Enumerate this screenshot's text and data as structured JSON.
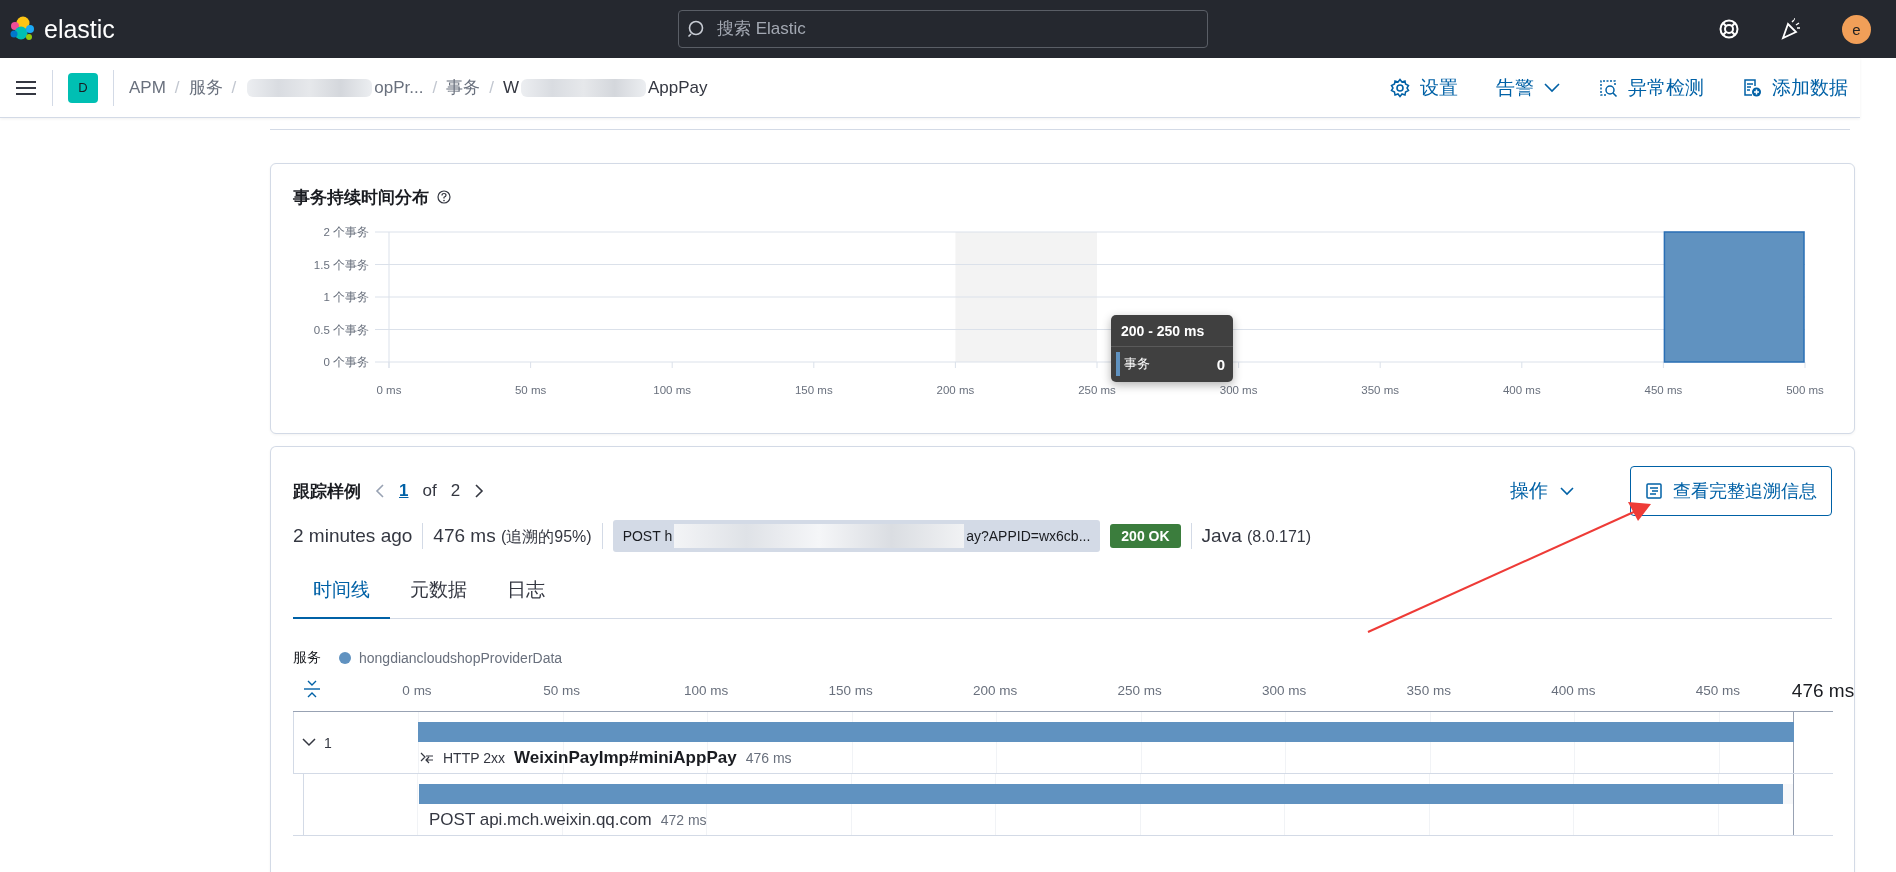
{
  "header": {
    "logo": "elastic",
    "search": {
      "placeholder": "搜索 Elastic"
    },
    "avatar": "e"
  },
  "breadcrumb_bar": {
    "space": "D",
    "separator": "/",
    "crumbs": [
      {
        "label": "APM",
        "current": false
      },
      {
        "label": "服务",
        "current": false
      },
      {
        "label": "opPr...",
        "redacted": true,
        "current": false
      },
      {
        "label": "事务",
        "current": false
      },
      {
        "prefix": "W",
        "label": "AppPay",
        "redacted": true,
        "current": true
      }
    ],
    "actions": [
      {
        "label": "设置",
        "dropdown": false
      },
      {
        "label": "告警",
        "dropdown": true
      },
      {
        "label": "异常检测",
        "dropdown": false
      },
      {
        "label": "添加数据",
        "dropdown": false
      }
    ]
  },
  "distribution": {
    "title": "事务持续时间分布",
    "chart_data": {
      "type": "bar",
      "x": [
        25,
        75,
        125,
        175,
        225,
        275,
        325,
        375,
        425,
        475
      ],
      "series": [
        {
          "name": "事务",
          "color": "#6092c0",
          "values": [
            0,
            0,
            0,
            0,
            0,
            0,
            0,
            0,
            0,
            2
          ]
        }
      ],
      "xlim": [
        0,
        500
      ],
      "ylim": [
        0,
        2
      ],
      "grid": true,
      "xticks": [
        {
          "value": 0,
          "label": "0 ms"
        },
        {
          "value": 50,
          "label": "50 ms"
        },
        {
          "value": 100,
          "label": "100 ms"
        },
        {
          "value": 150,
          "label": "150 ms"
        },
        {
          "value": 200,
          "label": "200 ms"
        },
        {
          "value": 250,
          "label": "250 ms"
        },
        {
          "value": 300,
          "label": "300 ms"
        },
        {
          "value": 350,
          "label": "350 ms"
        },
        {
          "value": 400,
          "label": "400 ms"
        },
        {
          "value": 450,
          "label": "450 ms"
        },
        {
          "value": 500,
          "label": "500 ms"
        }
      ],
      "yticks": [
        {
          "value": 0,
          "label": "0 个事务"
        },
        {
          "value": 0.5,
          "label": "0.5 个事务"
        },
        {
          "value": 1,
          "label": "1 个事务"
        },
        {
          "value": 1.5,
          "label": "1.5 个事务"
        },
        {
          "value": 2,
          "label": "2 个事务"
        }
      ],
      "bands": [
        {
          "axis": "x",
          "from": 200,
          "to": 250
        }
      ]
    },
    "tooltip": {
      "title": "200 - 250 ms",
      "value": "0"
    }
  },
  "trace_sample": {
    "title": "跟踪样例",
    "pagination": {
      "current": "1",
      "of": "of",
      "total": "2"
    },
    "actions_button": "操作",
    "full_trace_button": "查看完整追溯信息",
    "summary": {
      "time": "2 minutes ago",
      "duration": "476 ms",
      "percent": "(追溯的95%)",
      "url_start": "POST h",
      "url_end": "ay?APPID=wx6cb...",
      "url_redacted": true,
      "status": "200 OK",
      "agent": "Java",
      "agent_version": "(8.0.171)"
    },
    "tabs": [
      {
        "label": "时间线",
        "selected": true
      },
      {
        "label": "元数据",
        "selected": false
      },
      {
        "label": "日志",
        "selected": false
      }
    ],
    "timeline": {
      "legend_label": "服务",
      "services": [
        {
          "name": "hongdiancloudshopProviderData",
          "color": "#6092c0"
        }
      ],
      "ticks": [
        "0 ms",
        "50 ms",
        "100 ms",
        "150 ms",
        "200 ms",
        "250 ms",
        "300 ms",
        "350 ms",
        "400 ms",
        "450 ms"
      ],
      "total": "476 ms",
      "rows": [
        {
          "kind": "transaction",
          "expanded": true,
          "count": "1",
          "type": "HTTP 2xx",
          "name": "WeixinPayImp#miniAppPay",
          "duration": "476 ms",
          "level": 1,
          "children": [
            {
              "kind": "span",
              "name": "POST api.mch.weixin.qq.com",
              "duration": "472 ms",
              "level": 0.993
            }
          ]
        }
      ]
    }
  },
  "annotation": {
    "kind": "arrow"
  }
}
